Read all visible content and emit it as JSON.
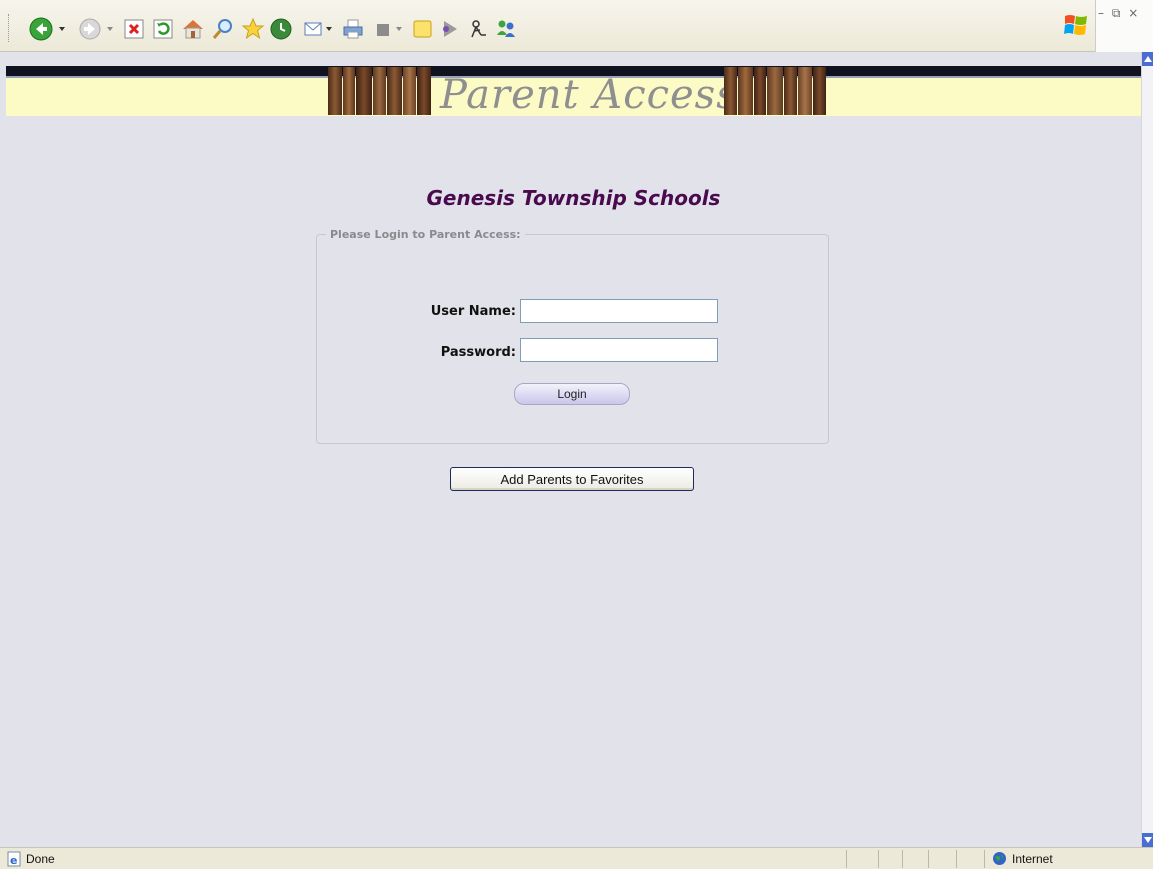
{
  "banner": {
    "title": "Parent Access"
  },
  "school": {
    "name": "Genesis Township Schools"
  },
  "login": {
    "legend": "Please Login to Parent Access:",
    "username_label": "User Name:",
    "password_label": "Password:",
    "username_value": "",
    "password_value": "",
    "login_button": "Login"
  },
  "favorites_button": "Add Parents to Favorites",
  "status": {
    "text": "Done",
    "zone": "Internet"
  },
  "window_controls": "– ⧉ ×",
  "colors": {
    "page_background": "#e2e3ea",
    "banner_background": "#fcfbc6",
    "school_name": "#4a0a4e",
    "toolbar": "#ece9d8"
  },
  "toolbar_icons": [
    "back-icon",
    "forward-icon",
    "stop-icon",
    "refresh-icon",
    "home-icon",
    "search-icon",
    "favorites-icon",
    "history-icon",
    "mail-icon",
    "print-icon",
    "edit-icon",
    "notes-icon",
    "media-icon",
    "research-icon",
    "messenger-icon"
  ]
}
